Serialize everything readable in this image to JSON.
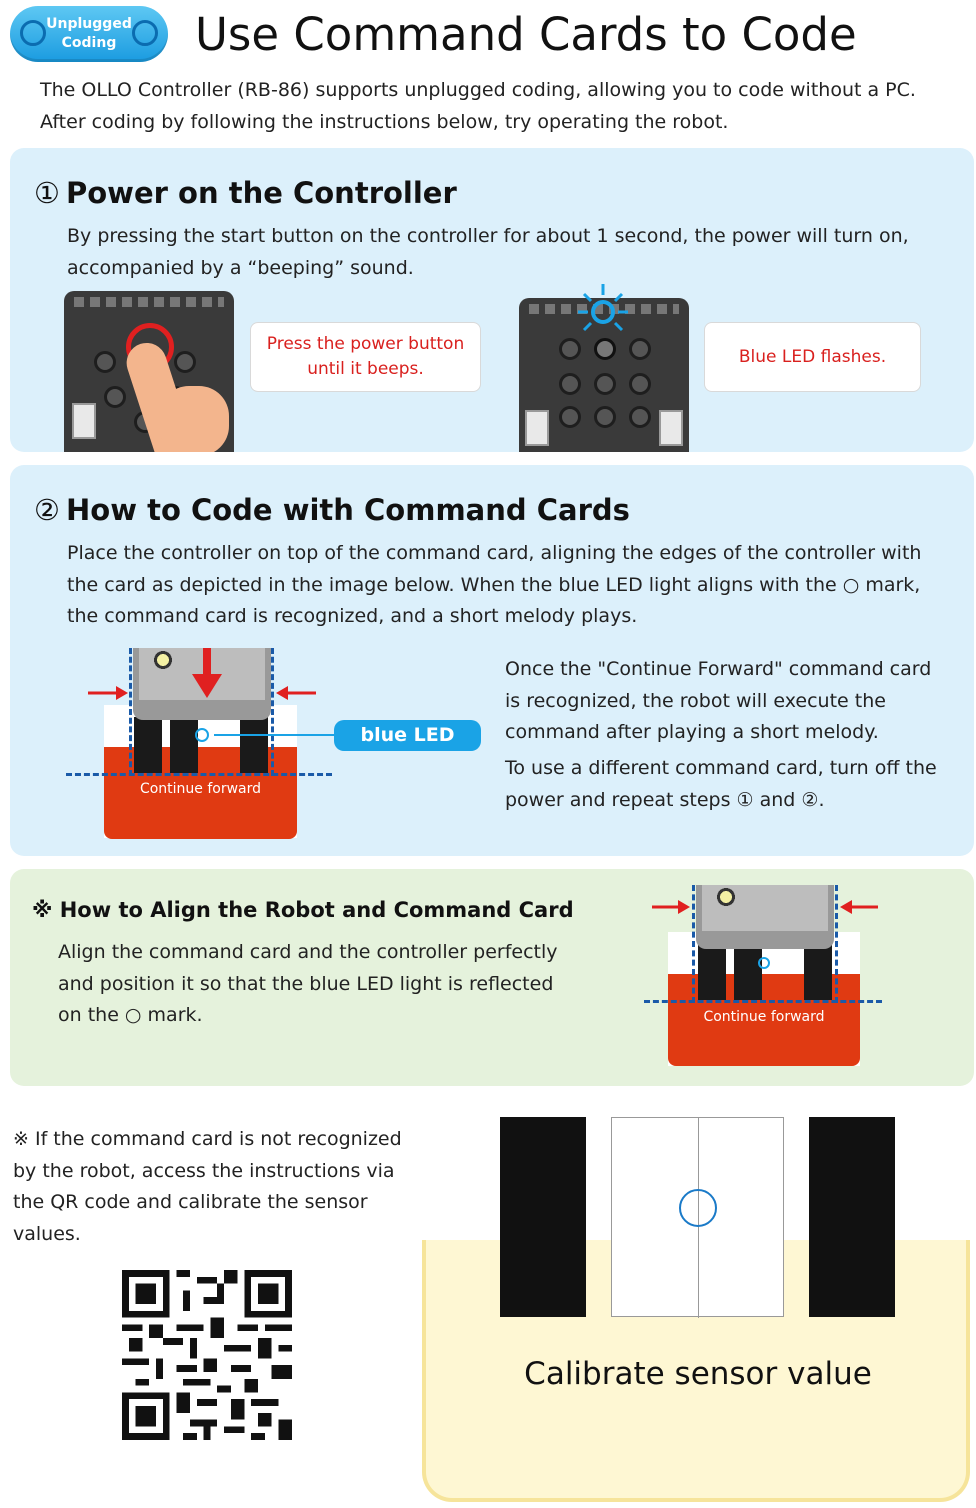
{
  "badge": {
    "line1": "Unplugged",
    "line2": "Coding"
  },
  "title": "Use Command Cards to Code",
  "intro": {
    "line1": "The OLLO Controller (RB-86) supports unplugged coding, allowing you to code without a PC.",
    "line2": "After coding by following the instructions below, try operating the robot."
  },
  "step1": {
    "num": "①",
    "title": "Power on the Controller",
    "text": "By pressing the start button on the controller for about 1 second, the power will turn on, accompanied by a “beeping” sound.",
    "callout1": "Press the power button until it beeps.",
    "callout2": "Blue LED flashes."
  },
  "step2": {
    "num": "②",
    "title": "How to Code with Command Cards",
    "text": "Place the controller on top of the command card, aligning the edges of the controller with the card as depicted in the image below. When the blue LED light aligns with the ○ mark, the command card is recognized, and a short melody plays.",
    "led_label": "blue LED",
    "card_label": "Continue forward",
    "side_text1": "Once the \"Continue Forward\" command card is recognized, the robot will execute the command after playing a short melody.",
    "side_text2": "To use a different command card, turn off the power and repeat steps ① and ②."
  },
  "align": {
    "title": "※ How to Align the Robot and Command Card",
    "text": "Align the command card and the controller perfectly and position it so that the blue LED light is reflected on the ○ mark.",
    "card_label": "Continue forward"
  },
  "calibrate": {
    "note": "※ If the command card is not recognized by the robot, access the instructions via the QR code and calibrate the sensor values.",
    "label": "Calibrate sensor value"
  },
  "colors": {
    "accent_blue": "#1aa3e6",
    "card_red": "#e03a12",
    "callout_red": "#d9201e",
    "panel_blue": "#dcf0fb",
    "panel_green": "#e5f2dc",
    "calib_yellow": "#fef7d3"
  }
}
